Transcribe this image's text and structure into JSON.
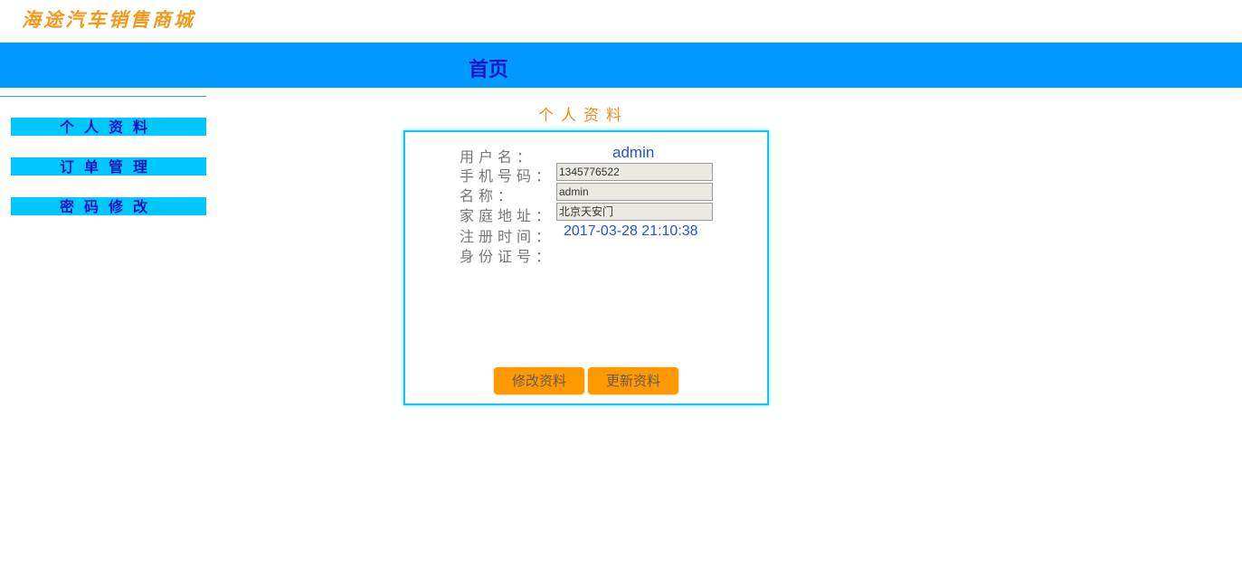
{
  "header": {
    "logo_text": "海途汽车销售商城",
    "nav_home": "首页"
  },
  "colors": {
    "nav_bar": "#0099ff",
    "sidebar_button": "#00c8ff",
    "accent_orange": "#ff9900",
    "panel_border": "#15c7f2"
  },
  "sidebar": {
    "items": [
      {
        "label": "个人资料"
      },
      {
        "label": "订单管理"
      },
      {
        "label": "密码修改"
      }
    ]
  },
  "profile": {
    "title": "个人资料",
    "username_label": "用户名：",
    "username_value": "admin",
    "phone_label": "手机号码：",
    "phone_value": "1345776522",
    "name_label": "名称：",
    "name_value": "admin",
    "address_label": "家庭地址：",
    "address_value": "北京天安门",
    "register_label": "注册时间：",
    "register_value": "2017-03-28 21:10:38",
    "idcard_label": "身份证号：",
    "idcard_value": ""
  },
  "actions": {
    "edit_label": "修改资料",
    "update_label": "更新资料"
  }
}
